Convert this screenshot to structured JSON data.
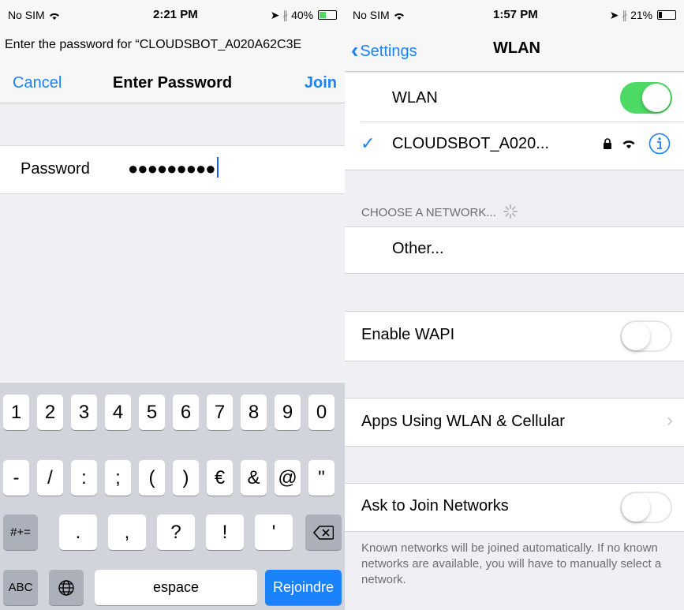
{
  "left": {
    "status": {
      "carrier": "No SIM",
      "time": "2:21 PM",
      "battery": "40%"
    },
    "prompt": "Enter the password for “CLOUDSBOT_A020A62C3E",
    "nav": {
      "cancel": "Cancel",
      "title": "Enter Password",
      "join": "Join"
    },
    "password": {
      "label": "Password",
      "masked": "●●●●●●●●●"
    },
    "keyboard": {
      "row1": [
        "1",
        "2",
        "3",
        "4",
        "5",
        "6",
        "7",
        "8",
        "9",
        "0"
      ],
      "row2": [
        "-",
        "/",
        ":",
        ";",
        "(",
        ")",
        "€",
        "&",
        "@",
        "\""
      ],
      "row3_mode": "#+=",
      "row3": [
        ".",
        ",",
        "?",
        "!",
        "'"
      ],
      "abc": "ABC",
      "space": "espace",
      "return": "Rejoindre"
    }
  },
  "right": {
    "status": {
      "carrier": "No SIM",
      "time": "1:57 PM",
      "battery": "21%"
    },
    "nav": {
      "back": "Settings",
      "title": "WLAN"
    },
    "wlan_label": "WLAN",
    "network_name": "CLOUDSBOT_A020...",
    "choose_header": "CHOOSE A NETWORK...",
    "other": "Other...",
    "wapi": "Enable WAPI",
    "apps": "Apps Using WLAN & Cellular",
    "ask": "Ask to Join Networks",
    "footer": "Known networks will be joined automatically. If no known networks are available, you will have to manually select a network."
  },
  "colors": {
    "accent": "#1a82fb",
    "toggle_on": "#4cd964"
  },
  "icons": [
    "wifi-icon",
    "bluetooth-icon",
    "location-icon",
    "battery-icon",
    "lock-icon",
    "info-icon",
    "checkmark-icon",
    "chevron-right-icon",
    "globe-icon",
    "backspace-icon",
    "spinner-icon"
  ]
}
